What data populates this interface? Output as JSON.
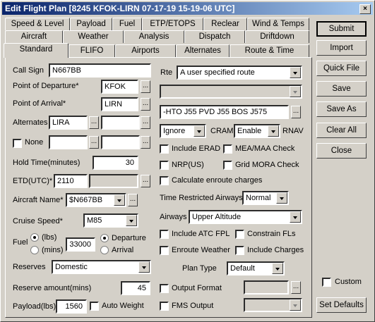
{
  "window": {
    "title": "Edit Flight Plan [8245 KFOK-LIRN 07-17-19 15-19-06 UTC]",
    "close": "×"
  },
  "tabs": {
    "row1": [
      "Speed & Level",
      "Payload",
      "Fuel",
      "ETP/ETOPS",
      "Reclear",
      "Wind & Temps"
    ],
    "row2": [
      "Aircraft",
      "Weather",
      "Analysis",
      "Dispatch",
      "Driftdown"
    ],
    "row3": [
      "Standard",
      "FLIFO",
      "Airports",
      "Alternates",
      "Route & Time"
    ]
  },
  "form": {
    "call_sign_label": "Call Sign",
    "call_sign": "N667BB",
    "departure_label": "Point of Departure*",
    "departure": "KFOK",
    "arrival_label": "Point of Arrival*",
    "arrival": "LIRN",
    "alternates_label": "Alternates",
    "alternate1": "LIRA",
    "alternate2": "",
    "none_label": "None",
    "none_field1": "",
    "none_field2": "",
    "hold_label": "Hold Time(minutes)",
    "hold": "30",
    "etd_label": "ETD(UTC)*",
    "etd": "2110",
    "aircraft_label": "Aircraft Name*",
    "aircraft": "$N667BB",
    "cruise_label": "Cruise Speed*",
    "cruise": "M85",
    "fuel_label": "Fuel",
    "fuel_lbs": "(lbs)",
    "fuel_mins": "(mins)",
    "fuel": "33000",
    "departure_radio": "Departure",
    "arrival_radio": "Arrival",
    "reserves_label": "Reserves",
    "reserves": "Domestic",
    "reserve_amount_label": "Reserve amount(mins)",
    "reserve_amount": "45",
    "payload_label": "Payload(lbs)",
    "payload": "1560",
    "auto_weight": "Auto Weight",
    "rte_label": "Rte",
    "rte": "A user specified route",
    "route_string": "-HTO J55 PVD J55 BOS J575",
    "ignore": "Ignore",
    "cram_label": "CRAM",
    "enable": "Enable",
    "rnav_label": "RNAV",
    "include_erad": "Include ERAD",
    "mea_maa": "MEA/MAA Check",
    "nrp": "NRP(US)",
    "grid_mora": "Grid MORA Check",
    "calc_enroute": "Calculate enroute charges",
    "time_restricted_label": "Time Restricted Airways",
    "time_restricted": "Normal",
    "airways_label": "Airways",
    "airways": "Upper Altitude",
    "include_atc": "Include ATC FPL",
    "constrain_fls": "Constrain FLs",
    "enroute_weather": "Enroute Weather",
    "include_charges": "Include Charges",
    "plan_type_label": "Plan Type",
    "plan_type": "Default",
    "output_format": "Output Format",
    "fms_output": "FMS Output",
    "custom": "Custom"
  },
  "buttons": {
    "submit": "Submit",
    "import": "Import",
    "quick_file": "Quick File",
    "save": "Save",
    "save_as": "Save As",
    "clear_all": "Clear All",
    "close": "Close",
    "set_defaults": "Set Defaults"
  },
  "dots": "..."
}
